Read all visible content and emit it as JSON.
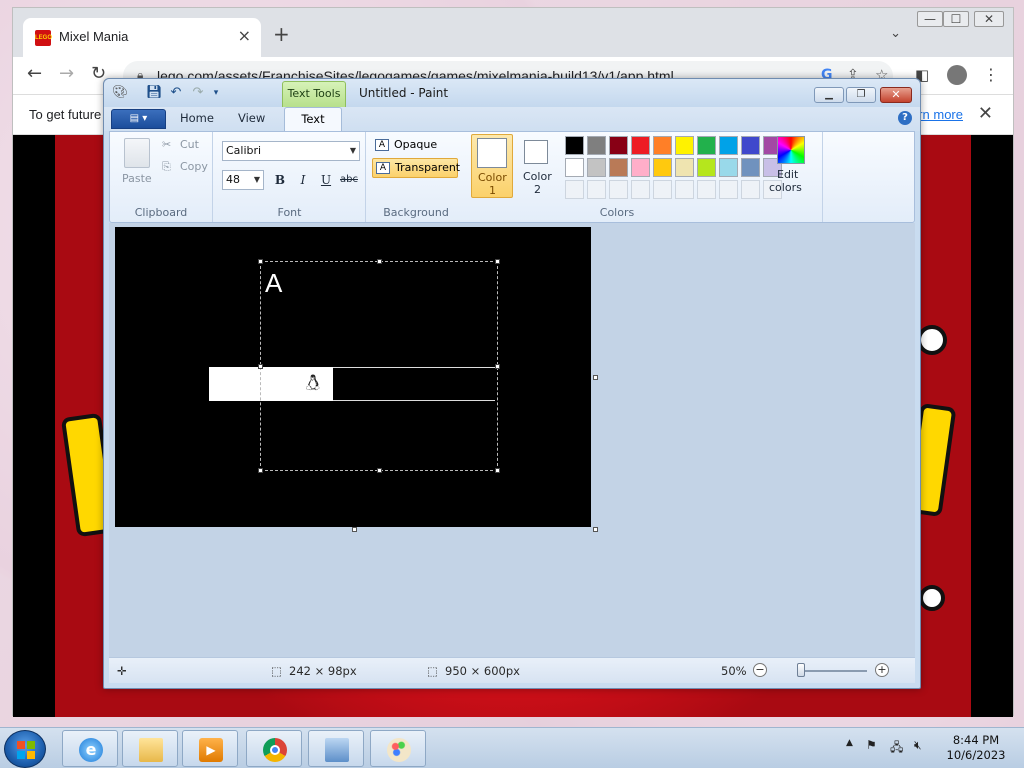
{
  "browser": {
    "tab_title": "Mixel Mania",
    "tab_close": "×",
    "new_tab": "+",
    "favicon_text": "LEGO",
    "url": "lego.com/assets/FranchiseSites/legogames/games/mixelmania-build13/v1/app.html",
    "infobar_text": "To get future",
    "infobar_link": "rn more",
    "infobar_close": "✕",
    "win_min": "—",
    "win_max": "☐",
    "win_close": "✕"
  },
  "paint": {
    "contextual_tab": "Text Tools",
    "title": "Untitled - Paint",
    "tabs": [
      {
        "label": "Home"
      },
      {
        "label": "View"
      },
      {
        "label": "Text"
      }
    ],
    "help": "?",
    "clipboard": {
      "paste": "Paste",
      "cut": "Cut",
      "copy": "Copy",
      "label": "Clipboard"
    },
    "font": {
      "family": "Calibri",
      "size": "48",
      "bold": "B",
      "italic": "I",
      "underline": "U",
      "strike": "abc",
      "label": "Font"
    },
    "background": {
      "opaque": "Opaque",
      "transparent": "Transparent",
      "label": "Background",
      "selected": "Transparent"
    },
    "colors": {
      "color1": "Color\n1",
      "color1_a": "Color",
      "color1_b": "1",
      "color2_a": "Color",
      "color2_b": "2",
      "edit_a": "Edit",
      "edit_b": "colors",
      "label": "Colors",
      "palette_row1": [
        "#000000",
        "#7f7f7f",
        "#880015",
        "#ed1c24",
        "#ff7f27",
        "#fff200",
        "#22b14c",
        "#00a2e8",
        "#3f48cc",
        "#a349a4"
      ],
      "palette_row2": [
        "#ffffff",
        "#c3c3c3",
        "#b97a57",
        "#ffaec9",
        "#ffc90e",
        "#efe4b0",
        "#b5e61d",
        "#99d9ea",
        "#7092be",
        "#c8bfe7"
      ]
    },
    "canvas_text": "A",
    "status": {
      "selection_size": "242 × 98px",
      "canvas_size": "950 × 600px",
      "zoom": "50%",
      "zoom_out": "−",
      "zoom_in": "+"
    }
  },
  "taskbar": {
    "time": "8:44 PM",
    "date": "10/6/2023"
  }
}
